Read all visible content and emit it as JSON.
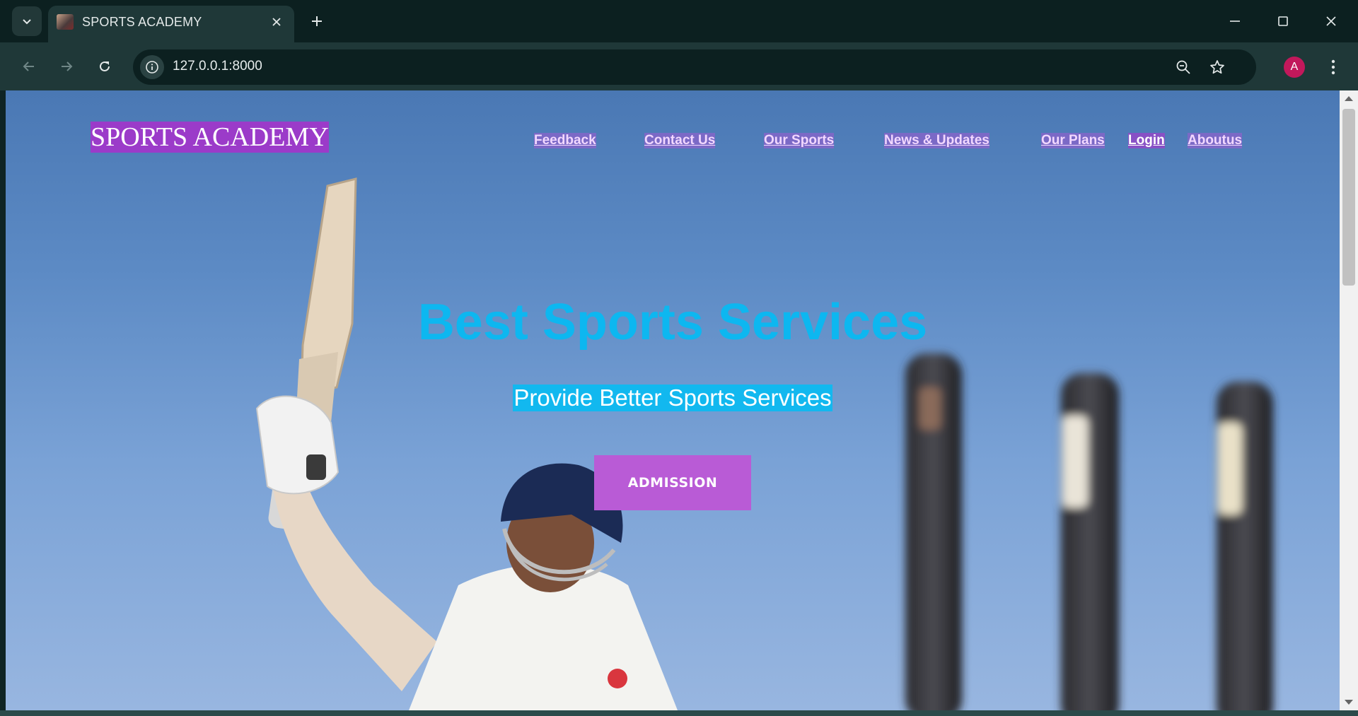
{
  "browser": {
    "tab_title": "SPORTS ACADEMY",
    "url": "127.0.0.1:8000",
    "profile_initial": "A"
  },
  "site": {
    "brand": "SPORTS ACADEMY",
    "nav": [
      "Feedback",
      "Contact Us",
      "Our Sports",
      "News & Updates",
      "Our Plans",
      "Login",
      "Aboutus"
    ],
    "headline": "Best Sports Services",
    "subheadline": "Provide Better Sports Services",
    "cta": "ADMISSION"
  },
  "colors": {
    "brand_bg": "#9b3bc9",
    "headline": "#0db7f0",
    "subheadline_bg": "#12b8ef",
    "cta_bg": "#b95bd6",
    "sky": "#5d8bc5"
  }
}
